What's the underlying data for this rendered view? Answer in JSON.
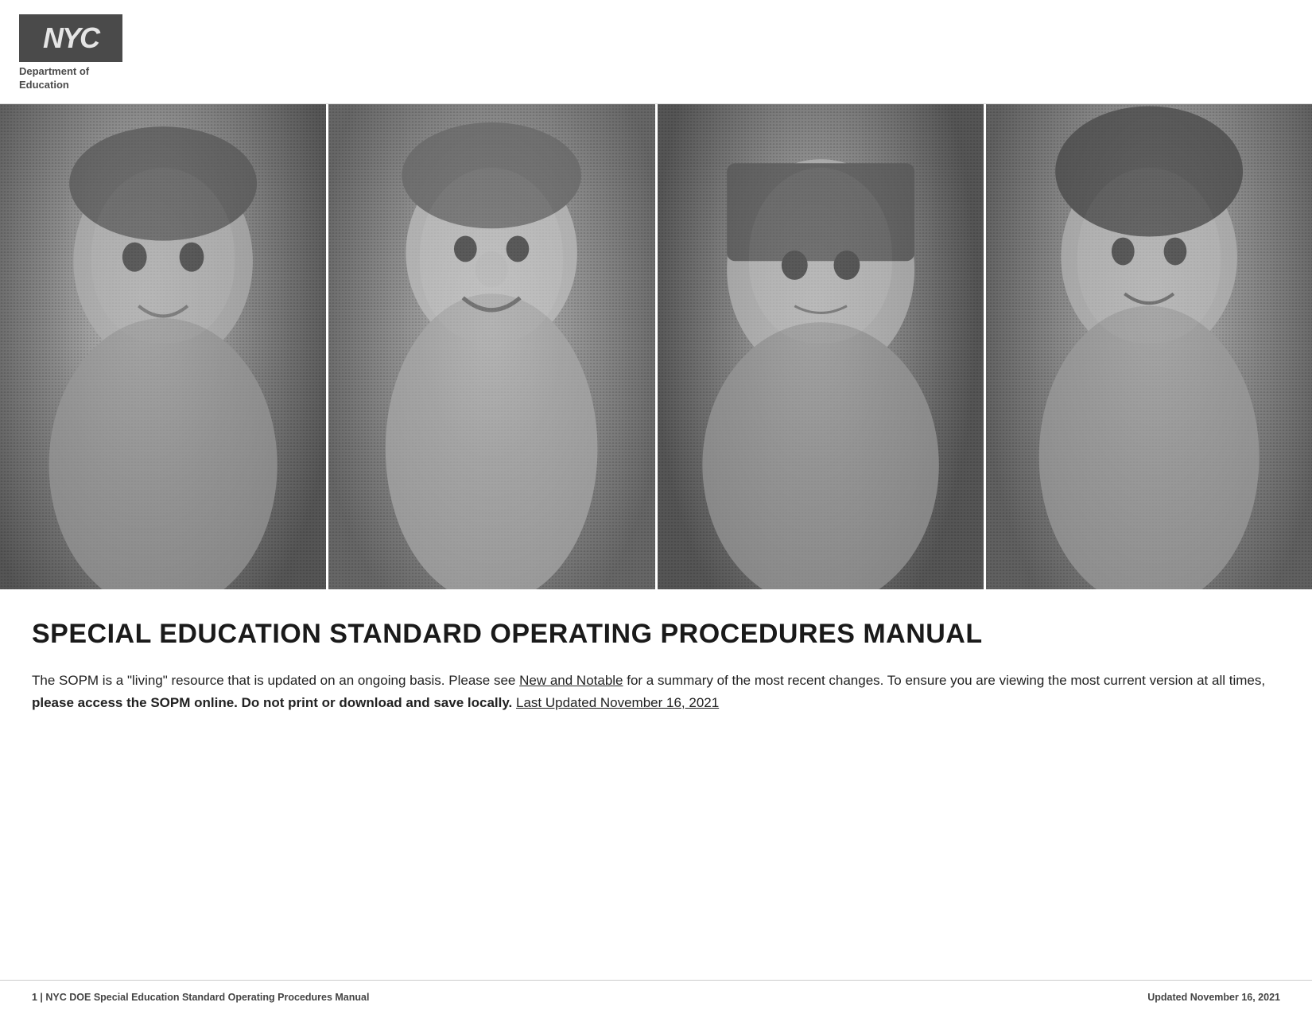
{
  "header": {
    "logo": {
      "letters": [
        "N",
        "Y",
        "C"
      ],
      "department_line1": "Department of",
      "department_line2": "Education"
    }
  },
  "hero": {
    "panels": [
      {
        "id": 1,
        "alt": "Child smiling outdoors"
      },
      {
        "id": 2,
        "alt": "Child laughing in wheelchair"
      },
      {
        "id": 3,
        "alt": "Girl with short hair smiling"
      },
      {
        "id": 4,
        "alt": "Teen boy smiling outdoors"
      }
    ]
  },
  "main": {
    "title": "SPECIAL EDUCATION STANDARD OPERATING PROCEDURES MANUAL",
    "description_part1": "The SOPM is a \"living\" resource that is updated on an ongoing basis. Please see ",
    "link_text": "New and Notable",
    "description_part2": " for a summary of the most recent changes. To ensure you are viewing the most current version at all times, ",
    "bold_text": "please access the SOPM online. Do not print or download and save locally.",
    "last_updated_label": "Last Updated November 16, 2021"
  },
  "footer": {
    "left_text": "1 | NYC DOE Special Education Standard Operating Procedures Manual",
    "right_text": "Updated November 16, 2021"
  }
}
